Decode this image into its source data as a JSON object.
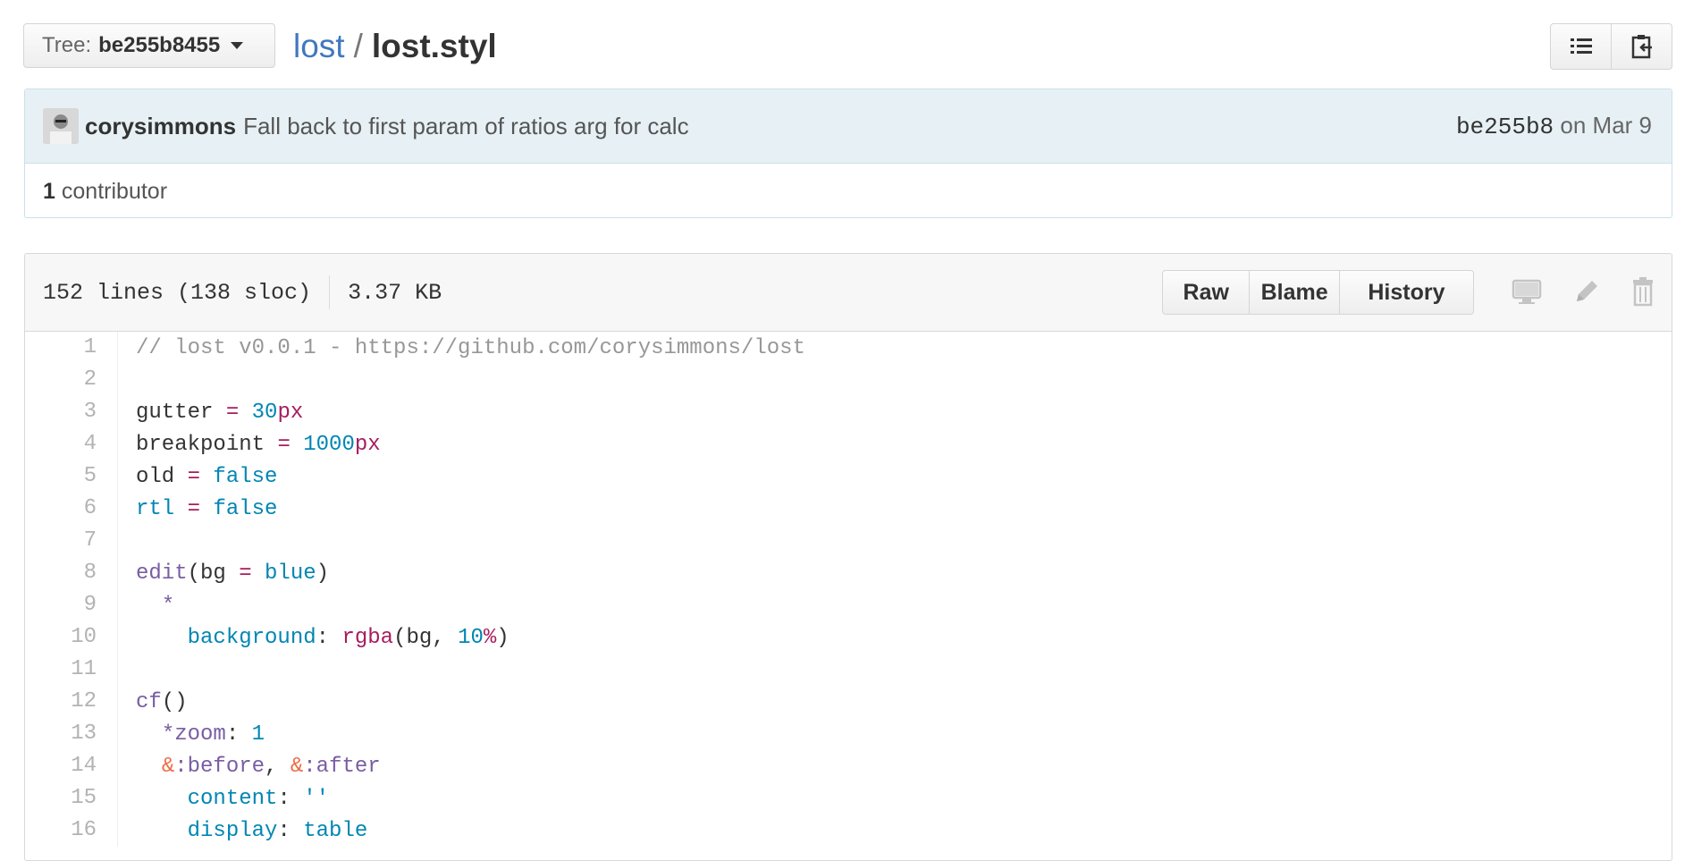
{
  "tree": {
    "label": "Tree:",
    "value": "be255b8455"
  },
  "breadcrumb": {
    "repo": "lost",
    "separator": "/",
    "file": "lost.styl"
  },
  "commit": {
    "author": "corysimmons",
    "message": "Fall back to first param of ratios arg for calc",
    "sha": "be255b8",
    "date_text": "on Mar 9"
  },
  "contributors": {
    "count": "1",
    "label": "contributor"
  },
  "file": {
    "lines_info": "152 lines (138 sloc)",
    "size": "3.37 KB",
    "actions": [
      "Raw",
      "Blame",
      "History"
    ]
  },
  "icons": {
    "file_list": "list-icon",
    "copy_path": "clipboard-icon",
    "desktop": "desktop-icon",
    "edit": "pencil-icon",
    "delete": "trash-icon"
  },
  "code_lines": [
    {
      "n": "1",
      "t": "// lost v0.0.1 - https://github.com/corysimmons/lost"
    },
    {
      "n": "2",
      "t": ""
    },
    {
      "n": "3",
      "t": "gutter = 30px"
    },
    {
      "n": "4",
      "t": "breakpoint = 1000px"
    },
    {
      "n": "5",
      "t": "old = false"
    },
    {
      "n": "6",
      "t": "rtl = false"
    },
    {
      "n": "7",
      "t": ""
    },
    {
      "n": "8",
      "t": "edit(bg = blue)"
    },
    {
      "n": "9",
      "t": "  *"
    },
    {
      "n": "10",
      "t": "    background: rgba(bg, 10%)"
    },
    {
      "n": "11",
      "t": ""
    },
    {
      "n": "12",
      "t": "cf()"
    },
    {
      "n": "13",
      "t": "  *zoom: 1"
    },
    {
      "n": "14",
      "t": "  &:before, &:after"
    },
    {
      "n": "15",
      "t": "    content: ''"
    },
    {
      "n": "16",
      "t": "    display: table"
    }
  ],
  "colors": {
    "link": "#4078c0",
    "commit_bg": "#e7f1f5",
    "comment": "#969896",
    "keyword": "#a71d5d",
    "constant": "#0086b3",
    "function": "#795da3",
    "operator": "#ed6a43"
  }
}
